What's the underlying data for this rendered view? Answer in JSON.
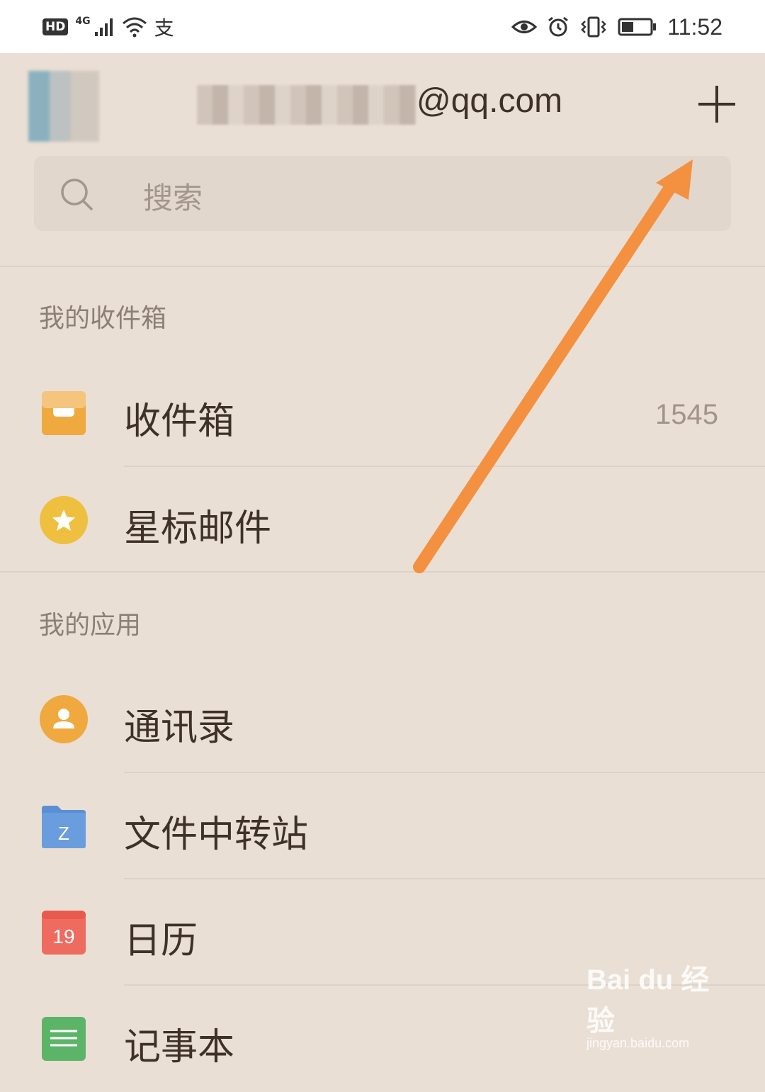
{
  "status_bar": {
    "hd": "HD",
    "network": "4G",
    "alipay_glyph": "支",
    "time": "11:52",
    "icons": [
      "signal-icon",
      "wifi-icon",
      "alipay-icon",
      "eye-icon",
      "alarm-icon",
      "vibrate-icon",
      "battery-icon"
    ]
  },
  "header": {
    "account_suffix": "@qq.com",
    "add_icon": "plus-icon"
  },
  "search": {
    "placeholder": "搜索",
    "icon": "search-icon"
  },
  "sections": {
    "inbox_title": "我的收件箱",
    "apps_title": "我的应用"
  },
  "inbox_items": [
    {
      "label": "收件箱",
      "count": "1545",
      "icon": "inbox-tray-icon",
      "color": "#f0a93f"
    },
    {
      "label": "星标邮件",
      "icon": "star-icon",
      "color": "#efc03f"
    }
  ],
  "app_items": [
    {
      "label": "通讯录",
      "icon": "contacts-icon",
      "color": "#f0a93f"
    },
    {
      "label": "文件中转站",
      "icon": "folder-icon",
      "color": "#5b8fd3",
      "badge": "Z"
    },
    {
      "label": "日历",
      "icon": "calendar-icon",
      "color": "#ee6b5f",
      "badge": "19"
    },
    {
      "label": "记事本",
      "icon": "notepad-icon",
      "color": "#5cb468"
    }
  ],
  "annotation": {
    "color": "#f39140"
  },
  "watermark": {
    "logo": "Bai du 经验",
    "site": "jingyan.baidu.com"
  }
}
